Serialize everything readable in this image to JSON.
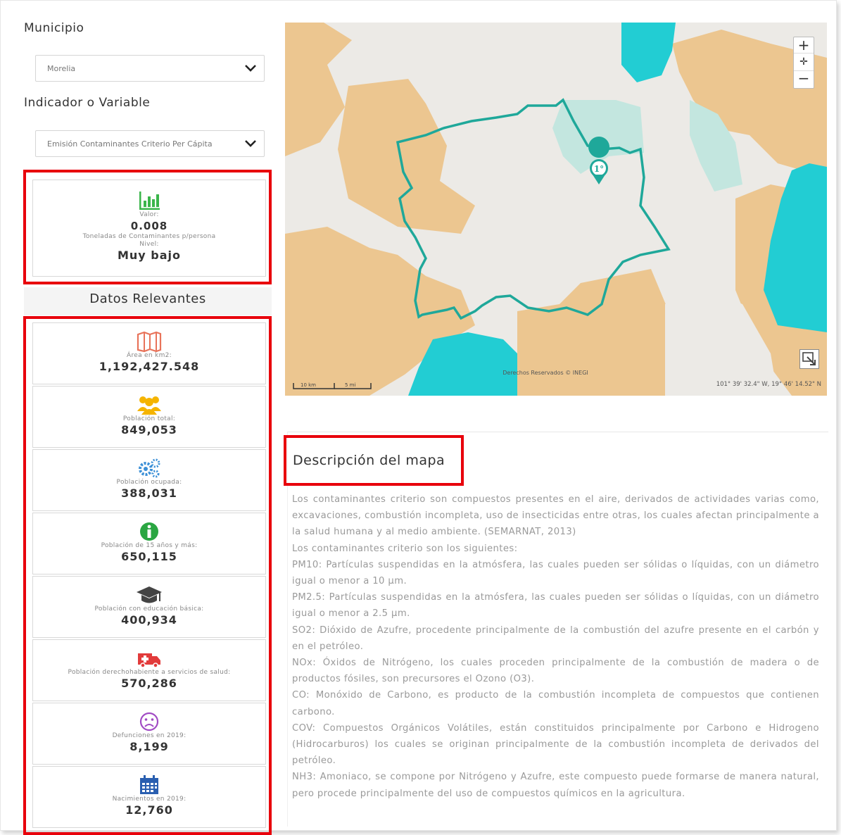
{
  "filters": {
    "municipio_label": "Municipio",
    "municipio_value": "Morelia",
    "indicador_label": "Indicador o Variable",
    "indicador_value": "Emisión Contaminantes Criterio Per Cápita"
  },
  "indicator": {
    "icon": "bar-chart-icon",
    "valor_label": "Valor:",
    "valor": "0.008",
    "unit": "Toneladas de Contaminantes p/persona",
    "nivel_label": "Nivel:",
    "nivel": "Muy bajo"
  },
  "relevantes_title": "Datos Relevantes",
  "stats": [
    {
      "icon": "map-icon",
      "label": "Área en km2:",
      "value": "1,192,427.548",
      "color": "#e8735a"
    },
    {
      "icon": "users-icon",
      "label": "Población total:",
      "value": "849,053",
      "color": "#f5b400"
    },
    {
      "icon": "gears-icon",
      "label": "Población ocupada:",
      "value": "388,031",
      "color": "#3b8fd6"
    },
    {
      "icon": "info-icon",
      "label": "Población de 15 años y más:",
      "value": "650,115",
      "color": "#2aa642"
    },
    {
      "icon": "graduation-cap-icon",
      "label": "Población con educación básica:",
      "value": "400,934",
      "color": "#444444"
    },
    {
      "icon": "ambulance-icon",
      "label": "Población derechohabiente a servicios de salud:",
      "value": "570,286",
      "color": "#e23b3b"
    },
    {
      "icon": "frown-icon",
      "label": "Defunciones en 2019:",
      "value": "8,199",
      "color": "#a14bc4"
    },
    {
      "icon": "calendar-icon",
      "label": "Nacimientos en 2019:",
      "value": "12,760",
      "color": "#2a5fb0"
    }
  ],
  "map": {
    "zoom_in": "+",
    "zoom_out": "−",
    "attribution": "Derechos Reservados © INEGI",
    "scale_km": "10 km",
    "scale_mi": "5 mi",
    "coords": "101° 39' 32.4\" W, 19° 46' 14.52\" N",
    "marker_label": "1°",
    "colors": {
      "tan": "#ecc690",
      "cyan": "#22cdd3",
      "lightcyan": "#c3e6df",
      "land": "#eceae6",
      "outline": "#1fa89a"
    }
  },
  "description": {
    "title": "Descripción del mapa",
    "paragraphs": [
      "Los contaminantes criterio son compuestos presentes en el aire, derivados de actividades varias como, excavaciones, combustión incompleta, uso de insecticidas entre otras, los cuales afectan principalmente a la salud humana y al medio ambiente. (SEMARNAT, 2013)",
      "Los contaminantes criterio son los siguientes:",
      "PM10: Partículas suspendidas en la atmósfera, las cuales pueden ser sólidas o líquidas, con un diámetro igual o menor a 10 μm.",
      "PM2.5: Partículas suspendidas en la atmósfera, las cuales pueden ser sólidas o líquidas, con un diámetro igual o menor a 2.5 μm.",
      "SO2: Dióxido de Azufre, procedente principalmente de la combustión del azufre presente en el carbón y en el petróleo.",
      "NOx: Óxidos de Nitrógeno, los cuales proceden principalmente de la combustión de madera o de productos fósiles, son precursores el Ozono (O3).",
      "CO: Monóxido de Carbono, es producto de la combustión incompleta de compuestos que contienen carbono.",
      "COV: Compuestos Orgánicos Volátiles, están constituidos principalmente por Carbono e Hidrogeno (Hidrocarburos) los cuales se originan principalmente de la combustión incompleta de derivados del petróleo.",
      "NH3: Amoniaco, se compone por Nitrógeno y Azufre, este compuesto puede formarse de manera natural, pero procede principalmente del uso de compuestos químicos en la agricultura."
    ]
  }
}
